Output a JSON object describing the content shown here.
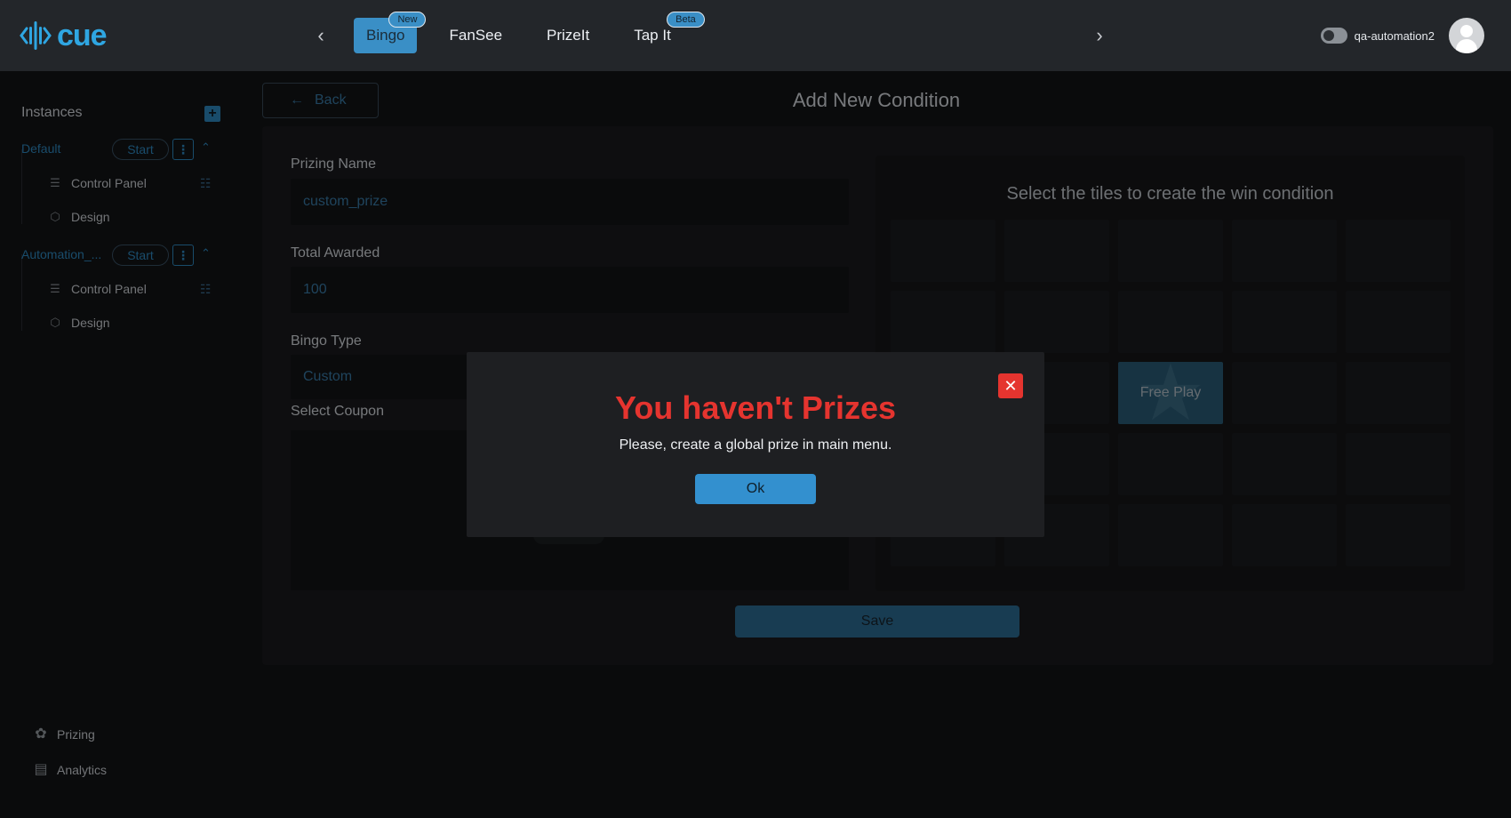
{
  "brand": {
    "logo_text": "cue",
    "accent": "#2fa6e2"
  },
  "header": {
    "tabs": [
      {
        "label": "Bingo",
        "badge": "New",
        "active": true
      },
      {
        "label": "FanSee",
        "badge": "",
        "active": false
      },
      {
        "label": "PrizeIt",
        "badge": "",
        "active": false
      },
      {
        "label": "Tap It",
        "badge": "Beta",
        "active": false
      }
    ],
    "username": "qa-automation2",
    "prev_icon": "chevron-left-icon",
    "next_icon": "chevron-right-icon"
  },
  "sidebar": {
    "title": "Instances",
    "add_icon": "plus-icon",
    "instances": [
      {
        "name": "Default",
        "start_label": "Start",
        "items": [
          "Control Panel",
          "Design"
        ]
      },
      {
        "name": "Automation_...",
        "start_label": "Start",
        "items": [
          "Control Panel",
          "Design"
        ]
      }
    ],
    "bottom": [
      {
        "label": "Prizing",
        "icon": "award-icon"
      },
      {
        "label": "Analytics",
        "icon": "bar-chart-icon"
      }
    ]
  },
  "main": {
    "back_label": "Back",
    "title": "Add New Condition",
    "form": {
      "prizing_name_label": "Prizing Name",
      "prizing_name_value": "custom_prize",
      "total_awarded_label": "Total Awarded",
      "total_awarded_value": "100",
      "bingo_type_label": "Bingo Type",
      "bingo_type_value": "Custom",
      "select_coupon_label": "Select Coupon"
    },
    "tiles": {
      "title": "Select the tiles to create the win condition",
      "free_label": "Free Play"
    },
    "save_label": "Save"
  },
  "modal": {
    "title": "You haven't Prizes",
    "message": "Please, create a global prize in main menu.",
    "ok_label": "Ok",
    "title_color": "#e5342f"
  }
}
